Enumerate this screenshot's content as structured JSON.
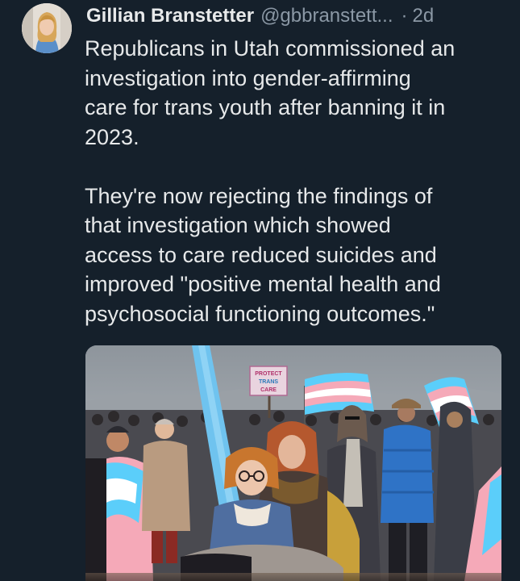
{
  "tweet": {
    "display_name": "Gillian Branstetter",
    "handle": "@gbbranstett...",
    "separator": "·",
    "time": "2d",
    "avatar_icon": "profile-photo-icon",
    "text": "Republicans in Utah commissioned an\ninvestigation into gender-affirming\ncare for trans youth after banning it in\n2023.\n\nThey're now rejecting the findings of\nthat investigation which showed\naccess to care reduced suicides and\nimproved \"positive mental health and\npsychosocial functioning outcomes.\"",
    "media": {
      "sign_text_line1": "PROTECT",
      "sign_text_line2": "TRANS",
      "sign_text_line3": "CARE"
    }
  },
  "colors": {
    "background": "#15202b",
    "text_primary": "#e7e9ea",
    "text_secondary": "#8b98a5",
    "trans_blue": "#5bcefa",
    "trans_pink": "#f5a9b8",
    "trans_white": "#ffffff"
  }
}
